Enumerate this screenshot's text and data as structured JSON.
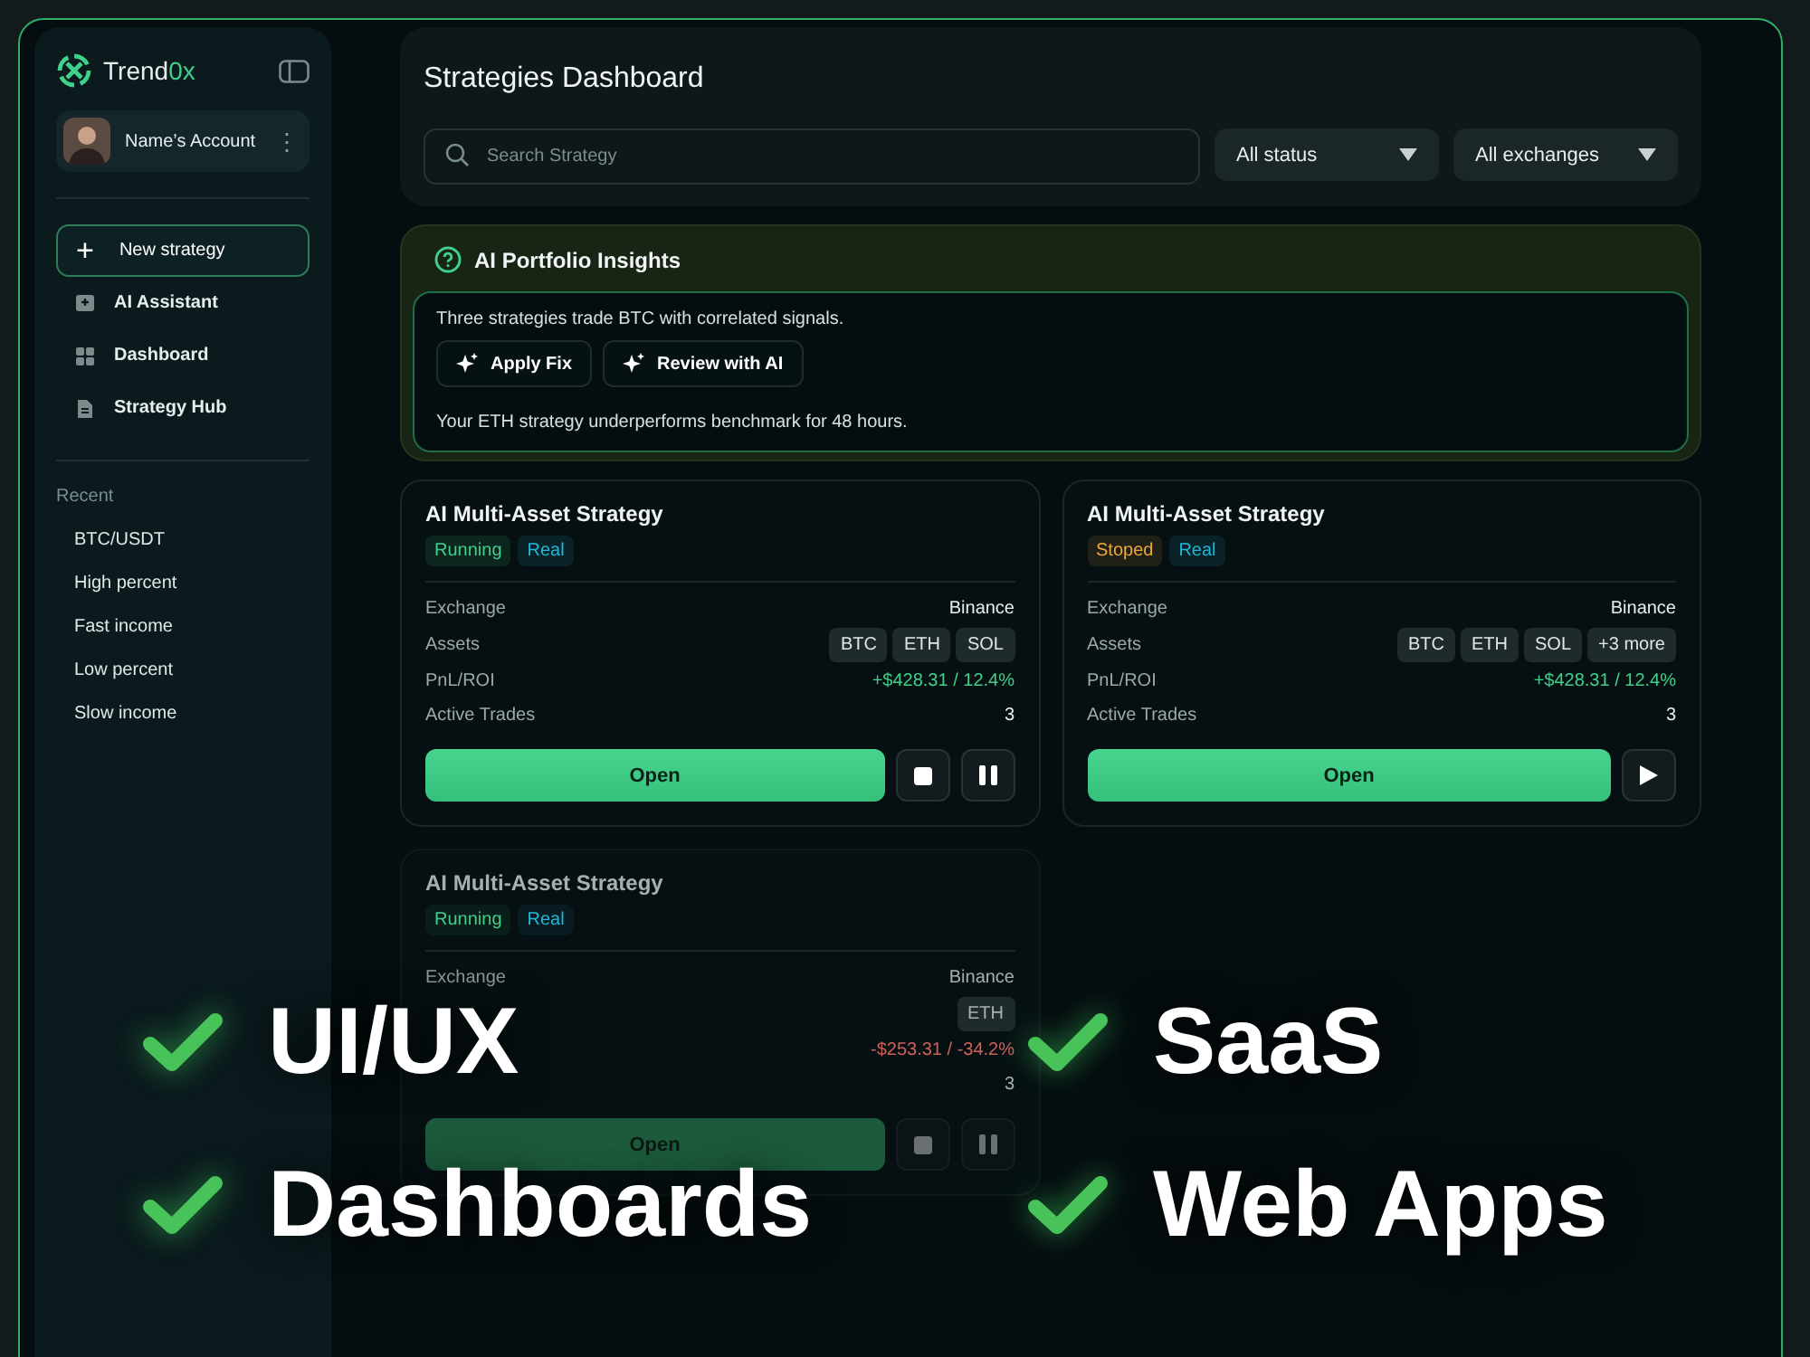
{
  "sidebar": {
    "brand": {
      "name": "Trend",
      "accent": "0x"
    },
    "account": {
      "name": "Name’s Account",
      "menu": "⋮"
    },
    "primary_action": {
      "label": "New strategy",
      "icon": "+"
    },
    "nav": [
      {
        "label": "AI Assistant",
        "kind": "assistant",
        "selected": false
      },
      {
        "label": "Dashboard",
        "kind": "dashboard",
        "selected": false
      },
      {
        "label": "Strategy Hub",
        "kind": "hub",
        "selected": false
      }
    ],
    "recent": {
      "title": "Recent",
      "items": [
        "BTC/USDT",
        "High percent",
        "Fast income",
        "Low percent",
        "Slow income"
      ]
    }
  },
  "header": {
    "title": "Strategies Dashboard",
    "search": {
      "placeholder": "Search Strategy"
    },
    "filters": [
      "All status",
      "All exchanges"
    ]
  },
  "insights": {
    "title": "AI Portfolio Insights",
    "messages": [
      {
        "text": "Three strategies trade BTC with correlated signals.",
        "actions": [
          "Apply Fix",
          "Review with AI"
        ]
      },
      {
        "text": "Your ETH strategy underperforms benchmark for 48 hours."
      }
    ]
  },
  "strategies": [
    {
      "title": "AI Multi-Asset Strategy",
      "dimmed": false,
      "tags": [
        {
          "label": "Running",
          "color": "#3fd08a"
        },
        {
          "label": "Real",
          "color": "#1fb8d8"
        }
      ],
      "rows": [
        {
          "label": "Exchange",
          "value": "Binance",
          "kind": "text"
        },
        {
          "label": "Assets",
          "assets": [
            "BTC",
            "ETH",
            "SOL"
          ],
          "kind": "assets"
        },
        {
          "label": "PnL/ROI",
          "value": "+$428.31 / 12.4%",
          "kind": "pnl",
          "positive": true
        },
        {
          "label": "Active Trades",
          "value": "3",
          "kind": "text"
        }
      ],
      "open": "Open",
      "actions": [
        {
          "kind": "stop"
        },
        {
          "kind": "pause"
        }
      ]
    },
    {
      "title": "AI Multi-Asset Strategy",
      "dimmed": false,
      "tags": [
        {
          "label": "Stoped",
          "color": "#f0a83a"
        },
        {
          "label": "Real",
          "color": "#1fb8d8"
        }
      ],
      "rows": [
        {
          "label": "Exchange",
          "value": "Binance",
          "kind": "text"
        },
        {
          "label": "Assets",
          "assets": [
            "BTC",
            "ETH",
            "SOL",
            "+3 more"
          ],
          "kind": "assets"
        },
        {
          "label": "PnL/ROI",
          "value": "+$428.31 / 12.4%",
          "kind": "pnl",
          "positive": true
        },
        {
          "label": "Active Trades",
          "value": "3",
          "kind": "text"
        }
      ],
      "open": "Open",
      "actions": [
        {
          "kind": "play"
        }
      ]
    },
    {
      "title": "AI Multi-Asset Strategy",
      "dimmed": true,
      "tags": [
        {
          "label": "Running",
          "color": "#3fd08a"
        },
        {
          "label": "Real",
          "color": "#1fb8d8"
        }
      ],
      "rows": [
        {
          "label": "Exchange",
          "value": "Binance",
          "kind": "text"
        },
        {
          "assets": [
            "ETH"
          ],
          "kind": "assets"
        },
        {
          "value": "-$253.31 / -34.2%",
          "kind": "pnl",
          "positive": false
        },
        {
          "value": "3",
          "kind": "text"
        }
      ],
      "open": "Open",
      "actions": [
        {
          "kind": "stop"
        },
        {
          "kind": "pause"
        }
      ]
    }
  ],
  "highlights": [
    "UI/UX",
    "SaaS",
    "Dashboards",
    "Web Apps"
  ]
}
